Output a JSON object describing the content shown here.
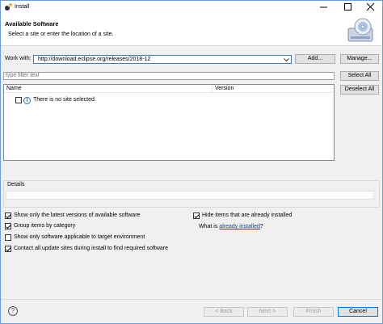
{
  "window": {
    "title": "Install"
  },
  "banner": {
    "title": "Available Software",
    "subtitle": "Select a site or enter the location of a site."
  },
  "work_with": {
    "label": "Work with:",
    "value": "http://download.eclipse.org/releases/2018-12",
    "add_label": "Add...",
    "manage_label": "Manage..."
  },
  "filter": {
    "placeholder": "type filter text"
  },
  "table": {
    "columns": [
      "Name",
      "Version"
    ],
    "rows": [
      {
        "name": "There is no site selected.",
        "version": ""
      }
    ]
  },
  "side_buttons": {
    "select_all": "Select All",
    "deselect_all": "Deselect All"
  },
  "details": {
    "label": "Details"
  },
  "options": {
    "latest_versions": {
      "label": "Show only the latest versions of available software",
      "checked": true
    },
    "group_by_category": {
      "label": "Group items by category",
      "checked": true
    },
    "target_env": {
      "label": "Show only software applicable to target environment",
      "checked": false
    },
    "contact_sites": {
      "label": "Contact all update sites during install to find required software",
      "checked": true
    },
    "hide_installed": {
      "label": "Hide items that are already installed",
      "checked": true
    },
    "what_is_prefix": "What is ",
    "what_is_link": "already installed",
    "what_is_suffix": "?"
  },
  "footer": {
    "back": "< Back",
    "next": "Next >",
    "finish": "Finish",
    "cancel": "Cancel"
  },
  "icons": {
    "title": "eclipse-install-icon",
    "banner": "cd-install-icon",
    "info": "info-icon",
    "help": "help-icon"
  }
}
